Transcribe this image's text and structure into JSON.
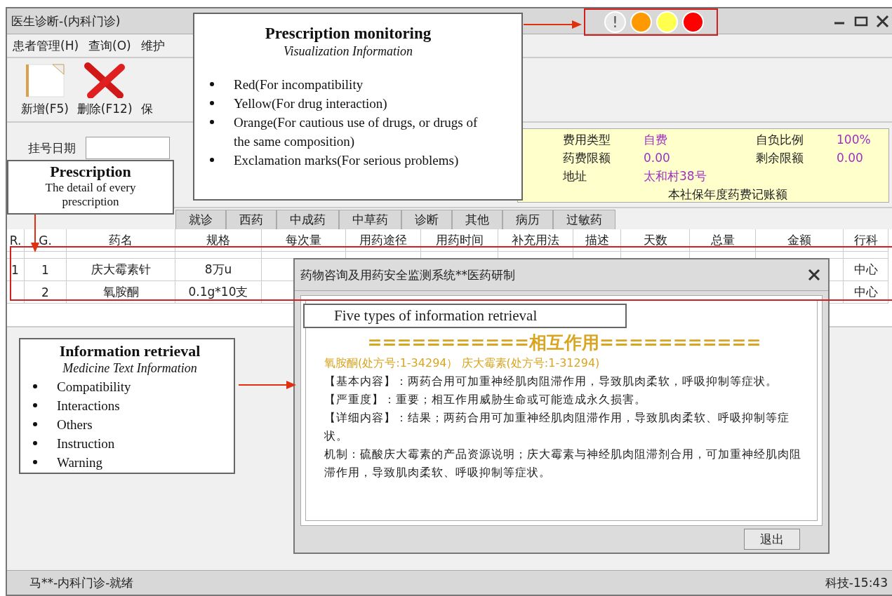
{
  "window": {
    "title": "医生诊断-(内科门诊)"
  },
  "status_lights": [
    {
      "kind": "exclamation",
      "symbol": "!",
      "color": "#e6e6e6"
    },
    {
      "kind": "dot",
      "color": "#ff9900"
    },
    {
      "kind": "dot",
      "color": "#ffff4d"
    },
    {
      "kind": "dot",
      "color": "#ff0000"
    }
  ],
  "menu": [
    "患者管理(H)",
    "查询(O)",
    "维护"
  ],
  "toolbar": [
    {
      "kind": "new",
      "label": "新增(F5)"
    },
    {
      "kind": "delete",
      "label": "删除(F12)"
    },
    {
      "kind": "covered",
      "label": "保"
    }
  ],
  "form": {
    "date_label": "挂号日期"
  },
  "patient_info": {
    "fields": [
      {
        "label": "费用类型",
        "value": "自费"
      },
      {
        "label": "自负比例",
        "value": "100%"
      },
      {
        "label": "药费限额",
        "value": "0.00"
      },
      {
        "label": "剩余限额",
        "value": "0.00"
      },
      {
        "label": "地址",
        "value": "太和村38号"
      }
    ],
    "note": "本社保年度药费记账额"
  },
  "tabs": [
    {
      "label": "就诊",
      "selected": false
    },
    {
      "label": "西药",
      "selected": false
    },
    {
      "label": "中成药",
      "selected": false
    },
    {
      "label": "中草药",
      "selected": false
    },
    {
      "label": "诊断",
      "selected": false
    },
    {
      "label": "其他",
      "selected": false
    },
    {
      "label": "病历",
      "selected": false
    },
    {
      "label": "过敏药",
      "selected": false
    }
  ],
  "table": {
    "columns": [
      "R.",
      "G.",
      "药名",
      "规格",
      "每次量",
      "用药途径",
      "用药时间",
      "补充用法",
      "描述",
      "天数",
      "总量",
      "金额",
      "行科"
    ],
    "rows": [
      {
        "r": "1",
        "g": "1",
        "drug": "庆大霉素针",
        "spec": "8万u",
        "dept": "中心"
      },
      {
        "g": "2",
        "drug": "氧胺酮",
        "spec": "0.1g*10支",
        "dept": "中心"
      }
    ]
  },
  "status_bar": {
    "left": "马**-内科门诊-就绪",
    "right": "科技-15:43"
  },
  "dialog": {
    "title": "药物咨询及用药安全监测系统**医药研制",
    "heading": "===========相互作用===========",
    "drugs": "氧胺酮(处方号:1-34294） 庆大霉素(处方号:1-31294)",
    "paragraphs": [
      "【基本内容】：两药合用可加重神经肌肉阻滞作用，导致肌肉柔软，呼吸抑制等症状。",
      "【严重度】：重要；相互作用威胁生命或可能造成永久损害。",
      "【详细内容】：结果；两药合用可加重神经肌肉阻滞作用，导致肌肉柔软、呼吸抑制等症状。",
      "机制：硫酸庆大霉素的产品资源说明；庆大霉素与神经肌肉阻滞剂合用，可加重神经肌肉阻滞作用，导致肌肉柔软、呼吸抑制等症状。"
    ],
    "button": "退出"
  },
  "annotations": {
    "monitoring": {
      "title": "Prescription monitoring",
      "subtitle": "Visualization Information",
      "bullets": [
        "Red(For incompatibility",
        "Yellow(For drug interaction)",
        "Orange(For cautious use of drugs, or drugs of the same composition)",
        "Exclamation marks(For serious problems)"
      ]
    },
    "prescription": {
      "title": "Prescription",
      "description": "The detail of every prescription"
    },
    "retrieval": {
      "title": "Information retrieval",
      "subtitle": "Medicine Text Information",
      "bullets": [
        "Compatibility",
        "Interactions",
        "Others",
        "Instruction",
        "Warning"
      ]
    },
    "dialog_label": "Five types of information retrieval"
  }
}
